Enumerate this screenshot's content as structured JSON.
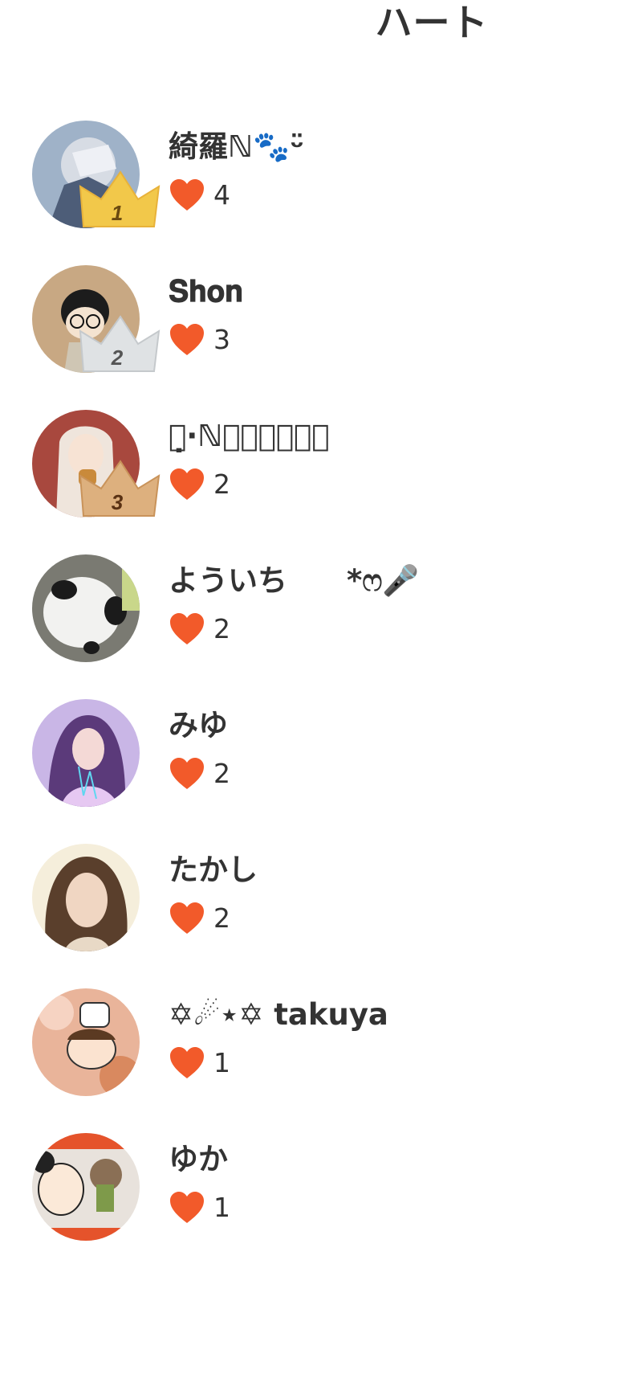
{
  "header": {
    "title": "ハート"
  },
  "colors": {
    "heart": "#f25a2a",
    "gold_crown": "#f2c84a",
    "silver_crown": "#cfd3d6",
    "bronze_crown": "#d8a06a"
  },
  "ranking": [
    {
      "rank": "1",
      "name": "綺羅ℕ🐾ᵕ̈",
      "hearts": "4",
      "crown": "gold"
    },
    {
      "rank": "2",
      "name": "𝐒𝐡𝐨𝐧",
      "hearts": "3",
      "crown": "silver"
    },
    {
      "rank": "3",
      "name": "〇̣·ℕ𝐚𝐭𝐬𝐮𝐤𝐢",
      "hearts": "2",
      "crown": "bronze"
    },
    {
      "rank": "",
      "name": "よういち　　*ෆ🎤",
      "hearts": "2",
      "crown": ""
    },
    {
      "rank": "",
      "name": "みゆ",
      "hearts": "2",
      "crown": ""
    },
    {
      "rank": "",
      "name": "たかし",
      "hearts": "2",
      "crown": ""
    },
    {
      "rank": "",
      "name": "✡︎☄︎⋆✡︎ takuya",
      "hearts": "1",
      "crown": ""
    },
    {
      "rank": "",
      "name": "ゆか",
      "hearts": "1",
      "crown": ""
    }
  ],
  "icons": {
    "heart": "heart-icon",
    "crown": "crown-icon"
  }
}
